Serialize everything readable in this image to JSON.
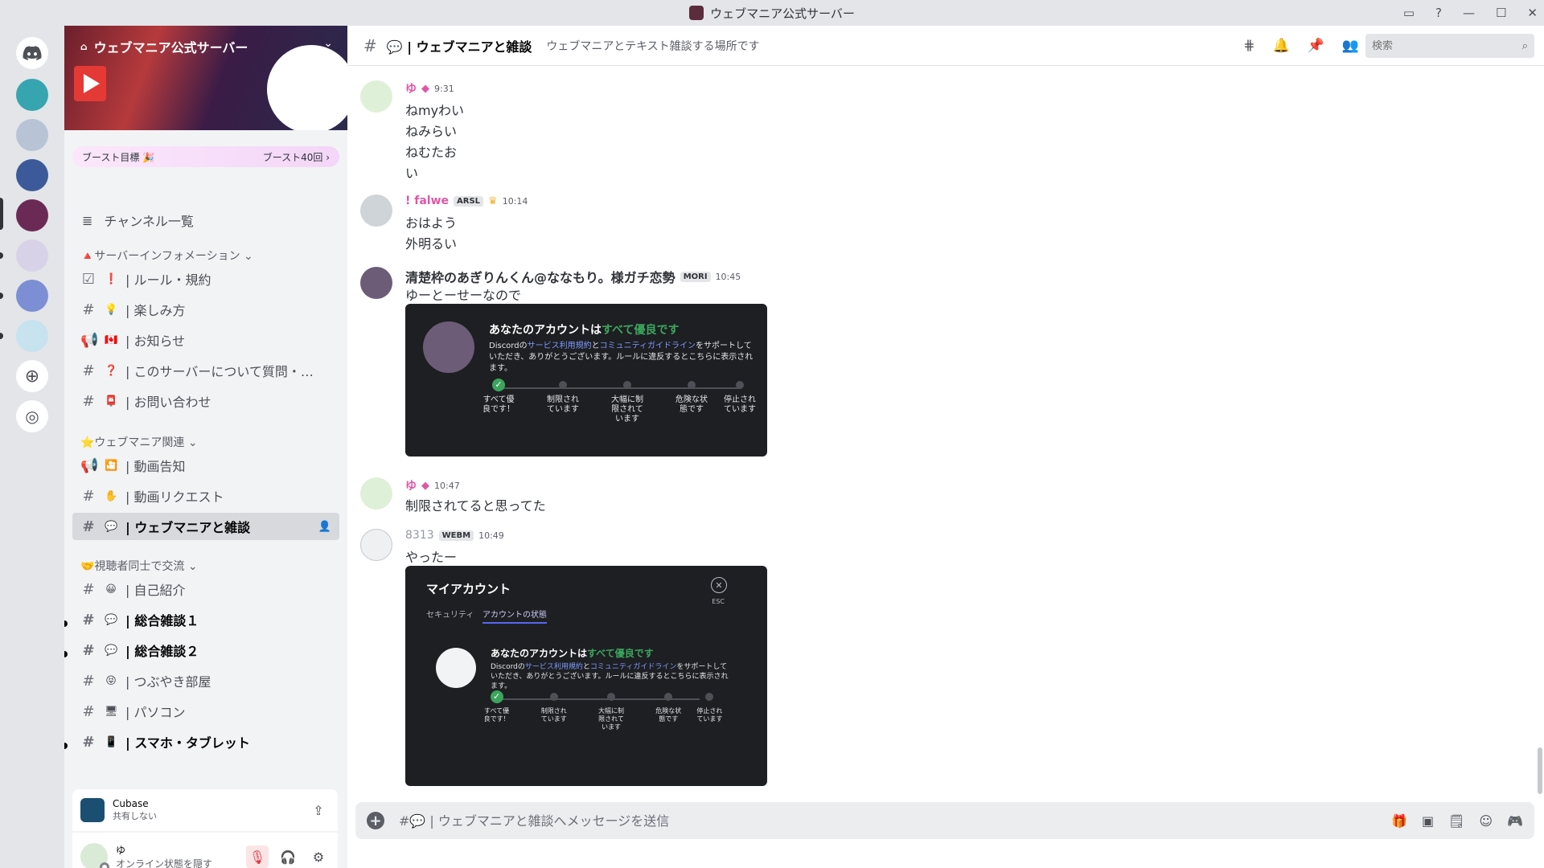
{
  "window": {
    "title": "ウェブマニア公式サーバー",
    "buttons": [
      "▭",
      "?",
      "—",
      "☐",
      "✕"
    ]
  },
  "server": {
    "name": "ウェブマニア公式サーバー",
    "boost_goal": "ブースト目標 🎉",
    "boost_count": "ブースト40回 ›",
    "channel_list_button": "チャンネル一覧"
  },
  "categories": [
    {
      "name": "🔺サーバーインフォメーション ⌄"
    },
    {
      "name": "⭐ウェブマニア関連 ⌄"
    },
    {
      "name": "🤝視聴者同士で交流 ⌄"
    }
  ],
  "channels": [
    {
      "label": "| ルール・規約",
      "emoji": "❗",
      "icon": "☑"
    },
    {
      "label": "| 楽しみ方",
      "emoji": "💡",
      "icon": "#"
    },
    {
      "label": "| お知らせ",
      "emoji": "🇨🇦",
      "icon": "📢"
    },
    {
      "label": "| このサーバーについて質問・…",
      "emoji": "❓",
      "icon": "#"
    },
    {
      "label": "| お問い合わせ",
      "emoji": "📮",
      "icon": "#"
    },
    {
      "label": "| 動画告知",
      "emoji": "🎦",
      "icon": "📢"
    },
    {
      "label": "| 動画リクエスト",
      "emoji": "✋",
      "icon": "#"
    },
    {
      "label": "| ウェブマニアと雑談",
      "emoji": "💬",
      "icon": "#"
    },
    {
      "label": "| 自己紹介",
      "emoji": "😀",
      "icon": "#"
    },
    {
      "label": "| 総合雑談１",
      "emoji": "💬",
      "icon": "#"
    },
    {
      "label": "| 総合雑談２",
      "emoji": "💬",
      "icon": "#"
    },
    {
      "label": "| つぶやき部屋",
      "emoji": "😝",
      "icon": "#"
    },
    {
      "label": "| パソコン",
      "emoji": "🖥",
      "icon": "#"
    },
    {
      "label": "| スマホ・タブレット",
      "emoji": "📱",
      "icon": "#"
    }
  ],
  "activity": {
    "app": "Cubase",
    "status": "共有しない"
  },
  "user": {
    "name": "ゆ",
    "status": "オンライン状態を隠す"
  },
  "header": {
    "channel": "💬 | ウェブマニアと雑談",
    "topic": "ウェブマニアとテキスト雑談する場所です",
    "search_placeholder": "検索"
  },
  "messages": [
    {
      "author": "ゆ",
      "color": "#e056a5",
      "time": "9:31",
      "lines": [
        "ねmyわい",
        "ねみらい",
        "ねむたお",
        "い"
      ]
    },
    {
      "author": "! falwe",
      "color": "#e056a5",
      "tag": "ARSL",
      "time": "10:14",
      "lines": [
        "おはよう",
        "外明るい"
      ]
    },
    {
      "author": "清楚枠のあぎりんくん@ななもり。様ガチ恋勢",
      "color": "#313338",
      "tag": "MORI",
      "time": "10:45",
      "lines": [
        "ゆーとーせーなので"
      ]
    },
    {
      "author": "ゆ",
      "color": "#e056a5",
      "time": "10:47",
      "lines": [
        "制限されてると思ってた"
      ]
    },
    {
      "author": "8313",
      "color": "#949ba4",
      "tag": "WEBM",
      "time": "10:49",
      "lines": [
        "やったー"
      ]
    }
  ],
  "card": {
    "title_a": "あなたのアカウントは",
    "title_b": "すべて優良です",
    "desc_a": "Discordの",
    "desc_link1": "サービス利用規約",
    "desc_mid": "と",
    "desc_link2": "コミュニティガイドライン",
    "desc_b": "をサポートしていただき、ありがとうございます。ルールに違反するとこちらに表示されます。",
    "steps": [
      "すべて優良です！",
      "制限されています",
      "大幅に制限されています",
      "危険な状態です",
      "停止されています"
    ]
  },
  "modal": {
    "title": "マイアカウント",
    "esc": "ESC",
    "tabs": [
      "セキュリティ",
      "アカウントの状態"
    ]
  },
  "composer": {
    "placeholder": "#💬 | ウェブマニアと雑談へメッセージを送信"
  },
  "colors": {
    "accent": "#5865f2",
    "green": "#3ba55d",
    "active_bg": "#d7d9dc"
  }
}
